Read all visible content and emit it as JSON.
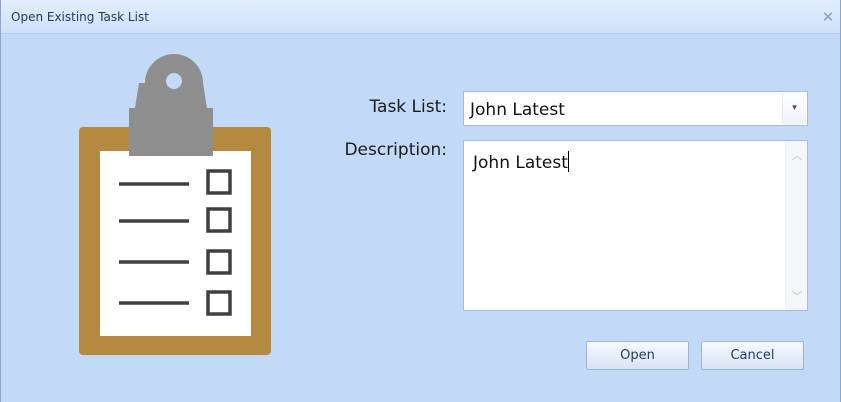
{
  "window": {
    "title": "Open Existing Task List",
    "close_glyph": "✕"
  },
  "illustration": {
    "icon": "clipboard-checklist-icon",
    "colors": {
      "board": "#b38a3f",
      "paper": "#ffffff",
      "clip": "#8e8e8e",
      "lines": "#404040"
    }
  },
  "form": {
    "task_list_label": "Task List:",
    "task_list_value": "John Latest",
    "description_label": "Description:",
    "description_value": "John Latest"
  },
  "buttons": {
    "open_label": "Open",
    "cancel_label": "Cancel"
  },
  "colors": {
    "dialog_background": "#c2d9f7",
    "title_text": "#1e395b"
  }
}
